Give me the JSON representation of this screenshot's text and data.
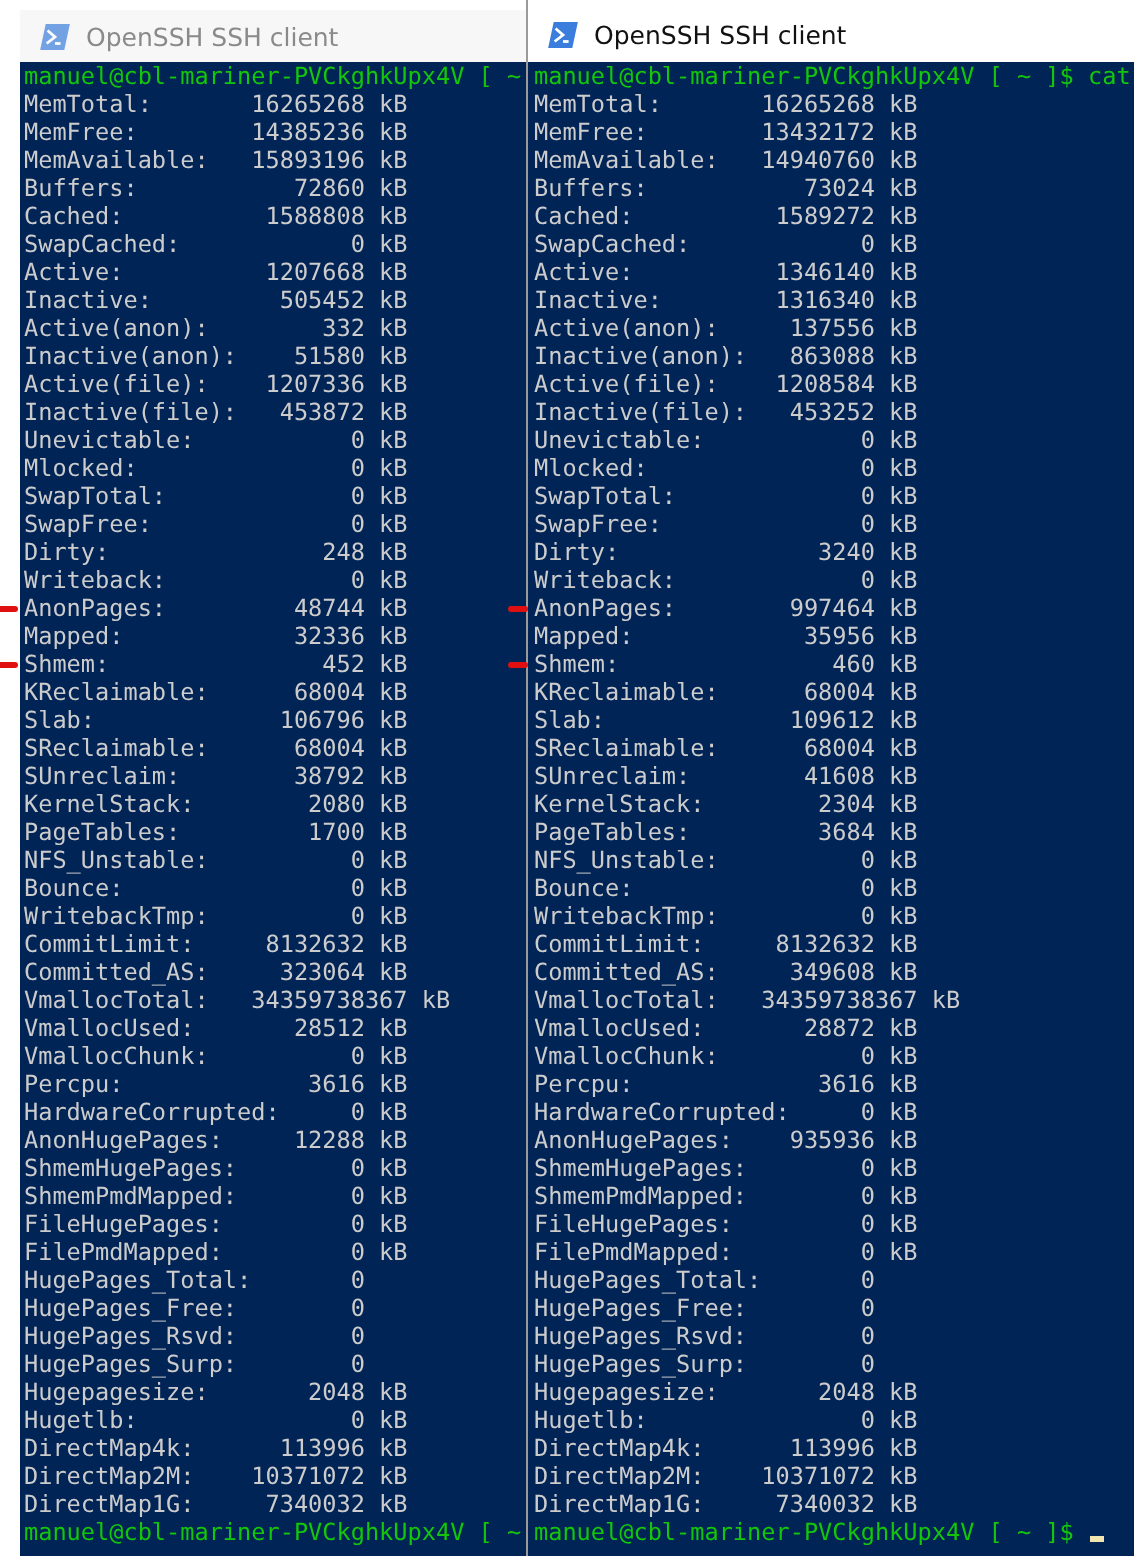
{
  "windows": [
    {
      "title": "OpenSSH SSH client",
      "active": false,
      "cursor": false,
      "lines": [
        {
          "kind": "prompt",
          "text": "manuel@cbl-mariner-PVCkghkUpx4V [ ~",
          "marked": false
        },
        {
          "kind": "output",
          "text": "MemTotal:       16265268 kB",
          "marked": false
        },
        {
          "kind": "output",
          "text": "MemFree:        14385236 kB",
          "marked": false
        },
        {
          "kind": "output",
          "text": "MemAvailable:   15893196 kB",
          "marked": false
        },
        {
          "kind": "output",
          "text": "Buffers:           72860 kB",
          "marked": false
        },
        {
          "kind": "output",
          "text": "Cached:          1588808 kB",
          "marked": false
        },
        {
          "kind": "output",
          "text": "SwapCached:            0 kB",
          "marked": false
        },
        {
          "kind": "output",
          "text": "Active:          1207668 kB",
          "marked": false
        },
        {
          "kind": "output",
          "text": "Inactive:         505452 kB",
          "marked": false
        },
        {
          "kind": "output",
          "text": "Active(anon):        332 kB",
          "marked": false
        },
        {
          "kind": "output",
          "text": "Inactive(anon):    51580 kB",
          "marked": false
        },
        {
          "kind": "output",
          "text": "Active(file):    1207336 kB",
          "marked": false
        },
        {
          "kind": "output",
          "text": "Inactive(file):   453872 kB",
          "marked": false
        },
        {
          "kind": "output",
          "text": "Unevictable:           0 kB",
          "marked": false
        },
        {
          "kind": "output",
          "text": "Mlocked:               0 kB",
          "marked": false
        },
        {
          "kind": "output",
          "text": "SwapTotal:             0 kB",
          "marked": false
        },
        {
          "kind": "output",
          "text": "SwapFree:              0 kB",
          "marked": false
        },
        {
          "kind": "output",
          "text": "Dirty:               248 kB",
          "marked": false
        },
        {
          "kind": "output",
          "text": "Writeback:             0 kB",
          "marked": false
        },
        {
          "kind": "output",
          "text": "AnonPages:         48744 kB",
          "marked": true
        },
        {
          "kind": "output",
          "text": "Mapped:            32336 kB",
          "marked": false
        },
        {
          "kind": "output",
          "text": "Shmem:               452 kB",
          "marked": true
        },
        {
          "kind": "output",
          "text": "KReclaimable:      68004 kB",
          "marked": false
        },
        {
          "kind": "output",
          "text": "Slab:             106796 kB",
          "marked": false
        },
        {
          "kind": "output",
          "text": "SReclaimable:      68004 kB",
          "marked": false
        },
        {
          "kind": "output",
          "text": "SUnreclaim:        38792 kB",
          "marked": false
        },
        {
          "kind": "output",
          "text": "KernelStack:        2080 kB",
          "marked": false
        },
        {
          "kind": "output",
          "text": "PageTables:         1700 kB",
          "marked": false
        },
        {
          "kind": "output",
          "text": "NFS_Unstable:          0 kB",
          "marked": false
        },
        {
          "kind": "output",
          "text": "Bounce:                0 kB",
          "marked": false
        },
        {
          "kind": "output",
          "text": "WritebackTmp:          0 kB",
          "marked": false
        },
        {
          "kind": "output",
          "text": "CommitLimit:     8132632 kB",
          "marked": false
        },
        {
          "kind": "output",
          "text": "Committed_AS:     323064 kB",
          "marked": false
        },
        {
          "kind": "output",
          "text": "VmallocTotal:   34359738367 kB",
          "marked": false
        },
        {
          "kind": "output",
          "text": "VmallocUsed:       28512 kB",
          "marked": false
        },
        {
          "kind": "output",
          "text": "VmallocChunk:          0 kB",
          "marked": false
        },
        {
          "kind": "output",
          "text": "Percpu:             3616 kB",
          "marked": false
        },
        {
          "kind": "output",
          "text": "HardwareCorrupted:     0 kB",
          "marked": false
        },
        {
          "kind": "output",
          "text": "AnonHugePages:     12288 kB",
          "marked": false
        },
        {
          "kind": "output",
          "text": "ShmemHugePages:        0 kB",
          "marked": false
        },
        {
          "kind": "output",
          "text": "ShmemPmdMapped:        0 kB",
          "marked": false
        },
        {
          "kind": "output",
          "text": "FileHugePages:         0 kB",
          "marked": false
        },
        {
          "kind": "output",
          "text": "FilePmdMapped:         0 kB",
          "marked": false
        },
        {
          "kind": "output",
          "text": "HugePages_Total:       0",
          "marked": false
        },
        {
          "kind": "output",
          "text": "HugePages_Free:        0",
          "marked": false
        },
        {
          "kind": "output",
          "text": "HugePages_Rsvd:        0",
          "marked": false
        },
        {
          "kind": "output",
          "text": "HugePages_Surp:        0",
          "marked": false
        },
        {
          "kind": "output",
          "text": "Hugepagesize:       2048 kB",
          "marked": false
        },
        {
          "kind": "output",
          "text": "Hugetlb:               0 kB",
          "marked": false
        },
        {
          "kind": "output",
          "text": "DirectMap4k:      113996 kB",
          "marked": false
        },
        {
          "kind": "output",
          "text": "DirectMap2M:    10371072 kB",
          "marked": false
        },
        {
          "kind": "output",
          "text": "DirectMap1G:     7340032 kB",
          "marked": false
        },
        {
          "kind": "prompt",
          "text": "manuel@cbl-mariner-PVCkghkUpx4V [ ~",
          "marked": false
        }
      ]
    },
    {
      "title": "OpenSSH SSH client",
      "active": true,
      "cursor": true,
      "lines": [
        {
          "kind": "prompt",
          "text": "manuel@cbl-mariner-PVCkghkUpx4V [ ~ ]$ cat",
          "marked": false
        },
        {
          "kind": "output",
          "text": "MemTotal:       16265268 kB",
          "marked": false
        },
        {
          "kind": "output",
          "text": "MemFree:        13432172 kB",
          "marked": false
        },
        {
          "kind": "output",
          "text": "MemAvailable:   14940760 kB",
          "marked": false
        },
        {
          "kind": "output",
          "text": "Buffers:           73024 kB",
          "marked": false
        },
        {
          "kind": "output",
          "text": "Cached:          1589272 kB",
          "marked": false
        },
        {
          "kind": "output",
          "text": "SwapCached:            0 kB",
          "marked": false
        },
        {
          "kind": "output",
          "text": "Active:          1346140 kB",
          "marked": false
        },
        {
          "kind": "output",
          "text": "Inactive:        1316340 kB",
          "marked": false
        },
        {
          "kind": "output",
          "text": "Active(anon):     137556 kB",
          "marked": false
        },
        {
          "kind": "output",
          "text": "Inactive(anon):   863088 kB",
          "marked": false
        },
        {
          "kind": "output",
          "text": "Active(file):    1208584 kB",
          "marked": false
        },
        {
          "kind": "output",
          "text": "Inactive(file):   453252 kB",
          "marked": false
        },
        {
          "kind": "output",
          "text": "Unevictable:           0 kB",
          "marked": false
        },
        {
          "kind": "output",
          "text": "Mlocked:               0 kB",
          "marked": false
        },
        {
          "kind": "output",
          "text": "SwapTotal:             0 kB",
          "marked": false
        },
        {
          "kind": "output",
          "text": "SwapFree:              0 kB",
          "marked": false
        },
        {
          "kind": "output",
          "text": "Dirty:              3240 kB",
          "marked": false
        },
        {
          "kind": "output",
          "text": "Writeback:             0 kB",
          "marked": false
        },
        {
          "kind": "output",
          "text": "AnonPages:        997464 kB",
          "marked": true
        },
        {
          "kind": "output",
          "text": "Mapped:            35956 kB",
          "marked": false
        },
        {
          "kind": "output",
          "text": "Shmem:               460 kB",
          "marked": true
        },
        {
          "kind": "output",
          "text": "KReclaimable:      68004 kB",
          "marked": false
        },
        {
          "kind": "output",
          "text": "Slab:             109612 kB",
          "marked": false
        },
        {
          "kind": "output",
          "text": "SReclaimable:      68004 kB",
          "marked": false
        },
        {
          "kind": "output",
          "text": "SUnreclaim:        41608 kB",
          "marked": false
        },
        {
          "kind": "output",
          "text": "KernelStack:        2304 kB",
          "marked": false
        },
        {
          "kind": "output",
          "text": "PageTables:         3684 kB",
          "marked": false
        },
        {
          "kind": "output",
          "text": "NFS_Unstable:          0 kB",
          "marked": false
        },
        {
          "kind": "output",
          "text": "Bounce:                0 kB",
          "marked": false
        },
        {
          "kind": "output",
          "text": "WritebackTmp:          0 kB",
          "marked": false
        },
        {
          "kind": "output",
          "text": "CommitLimit:     8132632 kB",
          "marked": false
        },
        {
          "kind": "output",
          "text": "Committed_AS:     349608 kB",
          "marked": false
        },
        {
          "kind": "output",
          "text": "VmallocTotal:   34359738367 kB",
          "marked": false
        },
        {
          "kind": "output",
          "text": "VmallocUsed:       28872 kB",
          "marked": false
        },
        {
          "kind": "output",
          "text": "VmallocChunk:          0 kB",
          "marked": false
        },
        {
          "kind": "output",
          "text": "Percpu:             3616 kB",
          "marked": false
        },
        {
          "kind": "output",
          "text": "HardwareCorrupted:     0 kB",
          "marked": false
        },
        {
          "kind": "output",
          "text": "AnonHugePages:    935936 kB",
          "marked": false
        },
        {
          "kind": "output",
          "text": "ShmemHugePages:        0 kB",
          "marked": false
        },
        {
          "kind": "output",
          "text": "ShmemPmdMapped:        0 kB",
          "marked": false
        },
        {
          "kind": "output",
          "text": "FileHugePages:         0 kB",
          "marked": false
        },
        {
          "kind": "output",
          "text": "FilePmdMapped:         0 kB",
          "marked": false
        },
        {
          "kind": "output",
          "text": "HugePages_Total:       0",
          "marked": false
        },
        {
          "kind": "output",
          "text": "HugePages_Free:        0",
          "marked": false
        },
        {
          "kind": "output",
          "text": "HugePages_Rsvd:        0",
          "marked": false
        },
        {
          "kind": "output",
          "text": "HugePages_Surp:        0",
          "marked": false
        },
        {
          "kind": "output",
          "text": "Hugepagesize:       2048 kB",
          "marked": false
        },
        {
          "kind": "output",
          "text": "Hugetlb:               0 kB",
          "marked": false
        },
        {
          "kind": "output",
          "text": "DirectMap4k:      113996 kB",
          "marked": false
        },
        {
          "kind": "output",
          "text": "DirectMap2M:    10371072 kB",
          "marked": false
        },
        {
          "kind": "output",
          "text": "DirectMap1G:     7340032 kB",
          "marked": false
        },
        {
          "kind": "prompt",
          "text": "manuel@cbl-mariner-PVCkghkUpx4V [ ~ ]$",
          "marked": false
        }
      ]
    }
  ]
}
